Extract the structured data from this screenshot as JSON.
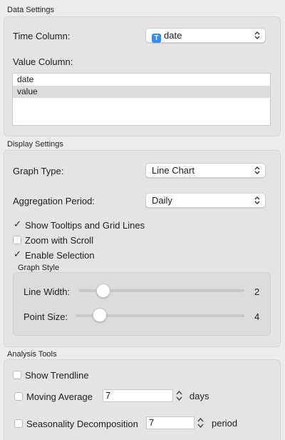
{
  "data_settings": {
    "title": "Data Settings",
    "time_column_label": "Time Column:",
    "time_column_value": "date",
    "time_column_type_badge": "T",
    "value_column_label": "Value Column:",
    "value_column_items": [
      {
        "label": "date",
        "selected": false
      },
      {
        "label": "value",
        "selected": true
      }
    ]
  },
  "display_settings": {
    "title": "Display Settings",
    "graph_type_label": "Graph Type:",
    "graph_type_value": "Line Chart",
    "aggregation_label": "Aggregation Period:",
    "aggregation_value": "Daily",
    "show_tooltips_label": "Show Tooltips and Grid Lines",
    "show_tooltips_checked": true,
    "zoom_scroll_label": "Zoom with Scroll",
    "zoom_scroll_checked": false,
    "enable_selection_label": "Enable Selection",
    "enable_selection_checked": true,
    "graph_style": {
      "title": "Graph Style",
      "line_width_label": "Line Width:",
      "line_width_value": "2",
      "point_size_label": "Point Size:",
      "point_size_value": "4"
    }
  },
  "analysis_tools": {
    "title": "Analysis Tools",
    "show_trendline_label": "Show Trendline",
    "show_trendline_checked": false,
    "moving_average_label": "Moving Average",
    "moving_average_checked": false,
    "moving_average_value": "7",
    "moving_average_unit": "days",
    "seasonality_label": "Seasonality Decomposition",
    "seasonality_checked": false,
    "seasonality_value": "7",
    "seasonality_unit": "period"
  },
  "colors": {
    "accent": "#2f8df5",
    "panel_bg": "#ececec",
    "group_bg": "#e4e4e4"
  },
  "icons": {
    "select_chevron": "chevron-up-down-icon",
    "checkmark": "checkmark-icon",
    "stepper": "stepper-arrows-icon"
  }
}
